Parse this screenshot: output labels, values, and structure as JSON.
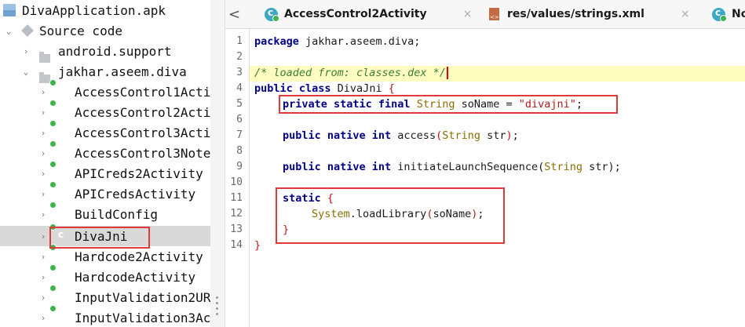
{
  "tree": {
    "root_label": "DivaApplication.apk",
    "source_code_label": "Source code",
    "packages": [
      "android.support",
      "jakhar.aseem.diva"
    ],
    "classes": [
      "AccessControl1Acti",
      "AccessControl2Acti",
      "AccessControl3Acti",
      "AccessControl3Note",
      "APICreds2Activity",
      "APICredsActivity",
      "BuildConfig",
      "DivaJni",
      "Hardcode2Activity",
      "HardcodeActivity",
      "InputValidation2UR",
      "InputValidation3Ac"
    ],
    "selected_class": "DivaJni"
  },
  "tabs": [
    {
      "label": "AccessControl2Activity",
      "close": "×",
      "icon": "class-icon"
    },
    {
      "label": "res/values/strings.xml",
      "close": "×",
      "icon": "xml-file-icon"
    },
    {
      "label": "No",
      "icon": "class-icon"
    }
  ],
  "tabbar": {
    "back_glyph": "<"
  },
  "editor": {
    "line_numbers": [
      "1",
      "2",
      "3",
      "4",
      "5",
      "6",
      "7",
      "8",
      "9",
      "10",
      "11",
      "12",
      "13",
      "14"
    ],
    "code": {
      "l1_kw": "package",
      "l1_rest": " jakhar.aseem.diva;",
      "l3_comment": "/* loaded from: classes.dex */",
      "l4_kw": "public class",
      "l4_name": " DivaJni ",
      "l4_brace": "{",
      "l5_kw": "private static final",
      "l5_type": " String",
      "l5_mid": " soName = ",
      "l5_str": "\"divajni\"",
      "l5_end": ";",
      "l7_kw": "public native int",
      "l7_mid": " access",
      "l7_p1": "(",
      "l7_type": "String",
      "l7_arg": " str",
      "l7_p2": ")",
      "l7_end": ";",
      "l9_kw": "public native int",
      "l9_mid": " initiateLaunchSequence(",
      "l9_type": "String",
      "l9_arg": " str",
      "l9_end": ");",
      "l11_kw": "static",
      "l11_brace": " {",
      "l12_type": "System",
      "l12_mid": ".loadLibrary",
      "l12_p1": "(",
      "l12_arg": "soName",
      "l12_p2": ")",
      "l12_end": ";",
      "l13_brace": "}",
      "l14_brace": "}"
    }
  },
  "colors": {
    "highlight_box": "#e0393b",
    "selection": "#d9d9d9",
    "comment_line_bg": "#fffdc0"
  }
}
